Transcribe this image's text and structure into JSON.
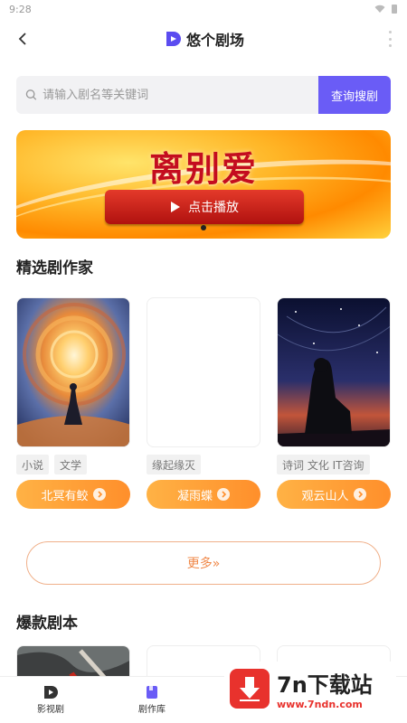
{
  "status": {
    "time": "9:28"
  },
  "app": {
    "title": "悠个剧场"
  },
  "search": {
    "placeholder": "请输入剧名等关键词",
    "button_label": "查询搜剧"
  },
  "banner": {
    "title": "离别爱",
    "play_label": "点击播放"
  },
  "section_writers": {
    "title": "精选剧作家"
  },
  "writers": [
    {
      "tags": [
        "小说",
        "文学"
      ],
      "name": "北冥有鲛"
    },
    {
      "tags": [
        "缘起缘灭"
      ],
      "name": "凝雨蝶"
    },
    {
      "tags": [
        "诗词 文化 IT咨询"
      ],
      "name": "观云山人"
    }
  ],
  "more_label": "更多»",
  "section_scripts": {
    "title": "爆款剧本"
  },
  "bottom_nav": [
    {
      "label": "影视剧",
      "icon": "brand-play-icon"
    },
    {
      "label": "剧作库",
      "icon": "book-icon"
    }
  ],
  "watermark": {
    "big": "7n下载站",
    "small": "www.7ndn.com"
  },
  "colors": {
    "accent": "#6a5cf6",
    "orange": "#ff9a35",
    "banner_red": "#c40d1f"
  }
}
